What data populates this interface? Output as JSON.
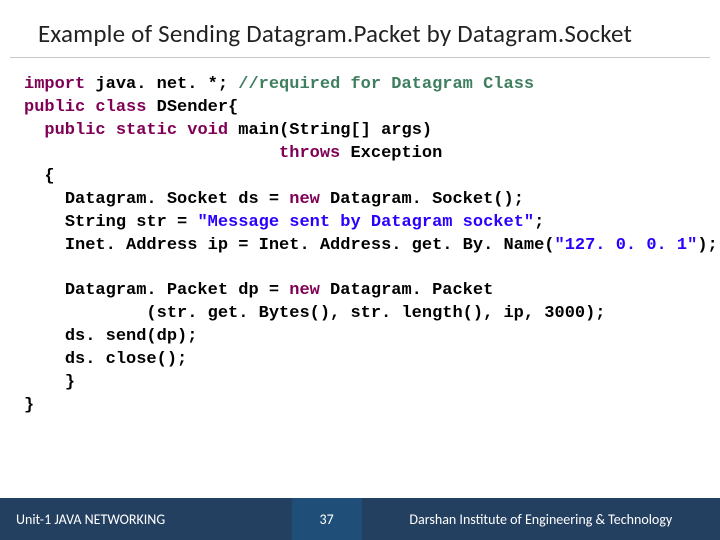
{
  "title": "Example of Sending Datagram.Packet by Datagram.Socket",
  "code": {
    "kw_import": "import",
    "import_pkg": " java. net. *; ",
    "import_comment": "//required for Datagram Class",
    "kw_public1": "public",
    "kw_class": "class",
    "cls_name": " DSender{",
    "kw_public2": "public",
    "kw_static": "static",
    "kw_void": "void",
    "main_sig": " main(String[] args)",
    "kw_throws": "throws",
    "throws_rest": " Exception",
    "brace_open": "{",
    "line_ds1": "Datagram. Socket ds = ",
    "kw_new1": "new",
    "line_ds2": " Datagram. Socket();",
    "line_str1": "String str = ",
    "str_lit": "\"Message sent by Datagram socket\"",
    "line_str2": ";",
    "line_ip": "Inet. Address ip = Inet. Address. get. By. Name(",
    "ip_lit": "\"127. 0. 0. 1\"",
    "line_ip2": ");",
    "line_dp1": "Datagram. Packet dp = ",
    "kw_new2": "new",
    "line_dp2": " Datagram. Packet",
    "line_dp3": "(str. get. Bytes(), str. length(), ip, 3000);",
    "line_send": "ds. send(dp);",
    "line_close": "ds. close();",
    "brace_close1": "}",
    "brace_close2": "}"
  },
  "footer": {
    "left": "Unit-1 JAVA NETWORKING",
    "page": "37",
    "right": "Darshan Institute of Engineering & Technology"
  }
}
